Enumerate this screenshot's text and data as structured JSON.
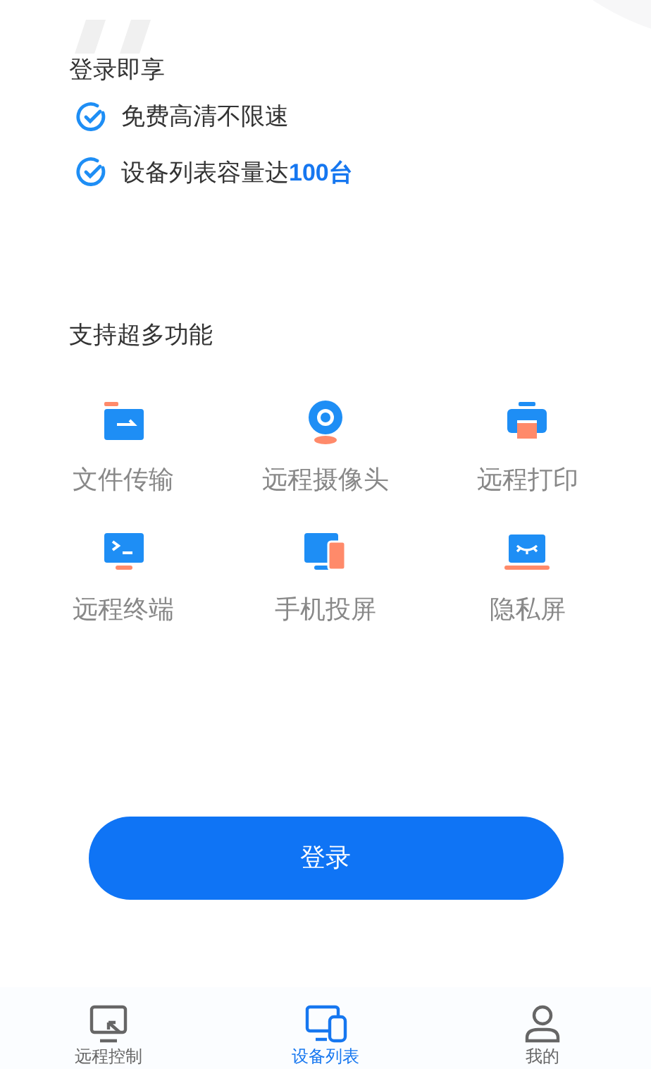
{
  "intro": {
    "title": "登录即享",
    "benefits": [
      {
        "text": "免费高清不限速"
      },
      {
        "text": "设备列表容量达**100台**"
      }
    ]
  },
  "features": {
    "title": "支持超多功能",
    "items": [
      {
        "kind": "folder",
        "label": "文件传输"
      },
      {
        "kind": "camera",
        "label": "远程摄像头"
      },
      {
        "kind": "printer",
        "label": "远程打印"
      },
      {
        "kind": "terminal",
        "label": "远程终端"
      },
      {
        "kind": "mirror",
        "label": "手机投屏"
      },
      {
        "kind": "privacy",
        "label": "隐私屏"
      }
    ]
  },
  "login_button": "登录",
  "tab_bar": [
    {
      "kind": "remote",
      "label": "远程控制",
      "selected": false
    },
    {
      "kind": "devices",
      "label": "设备列表",
      "selected": true
    },
    {
      "kind": "profile",
      "label": "我的",
      "selected": false
    }
  ]
}
